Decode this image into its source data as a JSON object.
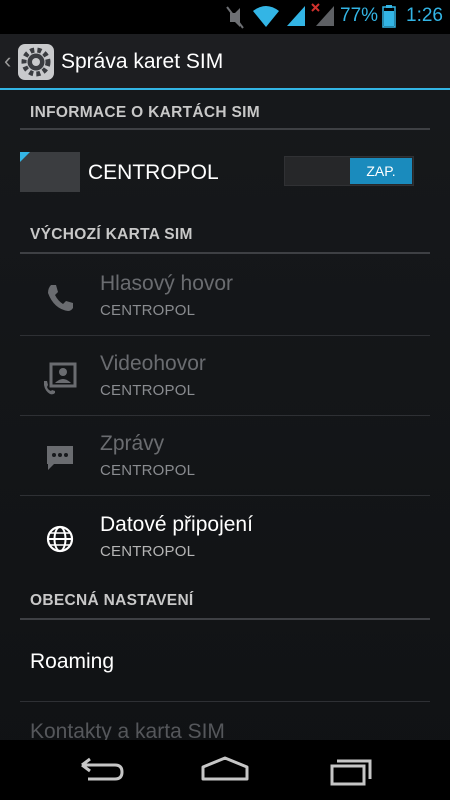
{
  "status_bar": {
    "battery_percent": "77%",
    "time": "1:26",
    "icons": [
      "mute-icon",
      "wifi-icon",
      "signal-icon",
      "signal-no-service-icon",
      "battery-icon"
    ]
  },
  "action_bar": {
    "title": "Správa karet SIM",
    "icon": "settings-gear-icon"
  },
  "sections": {
    "sim_info": "INFORMACE O KARTÁCH SIM",
    "default_sim": "VÝCHOZÍ KARTA SIM",
    "general": "OBECNÁ NASTAVENÍ"
  },
  "sim": {
    "name": "CENTROPOL",
    "toggle_label": "ZAP."
  },
  "default_sim_items": [
    {
      "label": "Hlasový hovor",
      "value": "CENTROPOL",
      "icon": "phone-icon",
      "enabled": false
    },
    {
      "label": "Videohovor",
      "value": "CENTROPOL",
      "icon": "video-call-icon",
      "enabled": false
    },
    {
      "label": "Zprávy",
      "value": "CENTROPOL",
      "icon": "message-icon",
      "enabled": false
    },
    {
      "label": "Datové připojení",
      "value": "CENTROPOL",
      "icon": "globe-icon",
      "enabled": true
    }
  ],
  "general_items": [
    {
      "label": "Roaming",
      "enabled": true
    },
    {
      "label": "Kontakty a karta SIM",
      "enabled": false
    }
  ],
  "nav_bar": [
    "back-icon",
    "home-icon",
    "recent-apps-icon"
  ],
  "colors": {
    "accent": "#33b5e5",
    "background": "#141619",
    "divider": "#3e4044"
  }
}
